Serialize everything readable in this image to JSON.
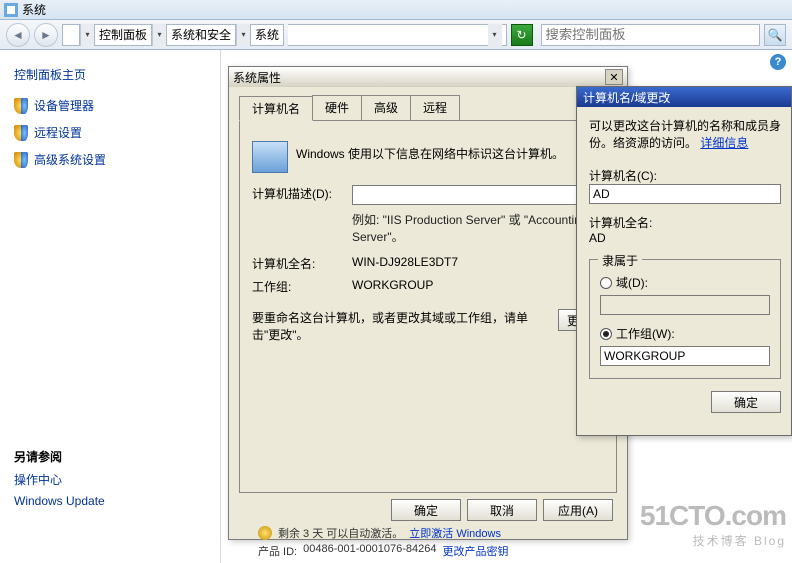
{
  "titlebar": {
    "title": "系统"
  },
  "navbar": {
    "segments": [
      "控制面板",
      "系统和安全",
      "系统"
    ],
    "search_placeholder": "搜索控制面板"
  },
  "sidebar": {
    "header": "控制面板主页",
    "items": [
      {
        "label": "设备管理器"
      },
      {
        "label": "远程设置"
      },
      {
        "label": "高级系统设置"
      }
    ],
    "see_also_title": "另请参阅",
    "see_also": [
      {
        "label": "操作中心"
      },
      {
        "label": "Windows Update"
      }
    ]
  },
  "sysprops": {
    "title": "系统属性",
    "tabs": [
      "计算机名",
      "硬件",
      "高级",
      "远程"
    ],
    "intro": "Windows 使用以下信息在网络中标识这台计算机。",
    "desc_label": "计算机描述(D):",
    "desc_value": "",
    "desc_hint": "例如: \"IIS Production Server\" 或 \"Accounting Server\"。",
    "fullname_label": "计算机全名:",
    "fullname_value": "WIN-DJ928LE3DT7",
    "workgroup_label": "工作组:",
    "workgroup_value": "WORKGROUP",
    "rename_msg": "要重命名这台计算机，或者更改其域或工作组，请单击\"更改\"。",
    "change_btn": "更改(",
    "ok": "确定",
    "cancel": "取消",
    "apply": "应用(A)"
  },
  "rename": {
    "title": "计算机名/域更改",
    "intro_a": "可以更改这台计算机的名称和成员身份。",
    "intro_b": "络资源的访问。",
    "more": "详细信息",
    "name_label": "计算机名(C):",
    "name_value": "AD",
    "fullname_label": "计算机全名:",
    "fullname_value": "AD",
    "member_label": "隶属于",
    "domain_label": "域(D):",
    "domain_value": "",
    "workgroup_label": "工作组(W):",
    "workgroup_value": "WORKGROUP",
    "ok": "确定"
  },
  "leak": {
    "line1_prefix": "剩余 3 天 可以自动激活。",
    "line1_link": "立即激活 Windows",
    "line2_label": "产品 ID:",
    "line2_value": "00486-001-0001076-84264",
    "line2_link": "更改产品密钥"
  },
  "watermark": {
    "big": "51CTO.com",
    "small": "技术博客  Blog"
  }
}
